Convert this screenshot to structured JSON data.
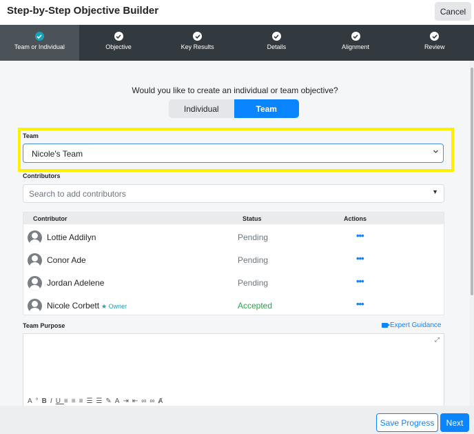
{
  "header": {
    "title": "Step-by-Step Objective Builder",
    "cancel_label": "Cancel"
  },
  "steps": [
    {
      "label": "Team or Individual",
      "icon": "check-circle-icon",
      "active": true
    },
    {
      "label": "Objective",
      "icon": "check-circle-icon"
    },
    {
      "label": "Key Results",
      "icon": "check-circle-icon"
    },
    {
      "label": "Details",
      "icon": "check-circle-icon"
    },
    {
      "label": "Alignment",
      "icon": "check-circle-icon"
    },
    {
      "label": "Review",
      "icon": "check-circle-icon"
    }
  ],
  "main": {
    "question": "Would you like to create an individual or team objective?",
    "toggle": {
      "individual_label": "Individual",
      "team_label": "Team",
      "selected": "Team"
    },
    "team": {
      "label": "Team",
      "value": "Nicole's Team"
    },
    "contributors": {
      "label": "Contributors",
      "search_placeholder": "Search to add contributors",
      "columns": {
        "contributor": "Contributor",
        "status": "Status",
        "actions": "Actions"
      },
      "rows": [
        {
          "name": "Lottie Addilyn",
          "status": "Pending",
          "actions": "•••"
        },
        {
          "name": "Conor Ade",
          "status": "Pending",
          "actions": "•••"
        },
        {
          "name": "Jordan Adelene",
          "status": "Pending",
          "actions": "•••"
        },
        {
          "name": "Nicole Corbett",
          "badge": "Owner",
          "status": "Accepted",
          "actions": "•••"
        }
      ]
    },
    "purpose": {
      "label": "Team Purpose",
      "guidance_label": "Expert Guidance"
    }
  },
  "footer": {
    "save_label": "Save Progress",
    "next_label": "Next"
  },
  "colors": {
    "accent": "#0b84ff",
    "stepbar": "#32393f",
    "accepted": "#28a745",
    "highlight": "#ffef00"
  }
}
